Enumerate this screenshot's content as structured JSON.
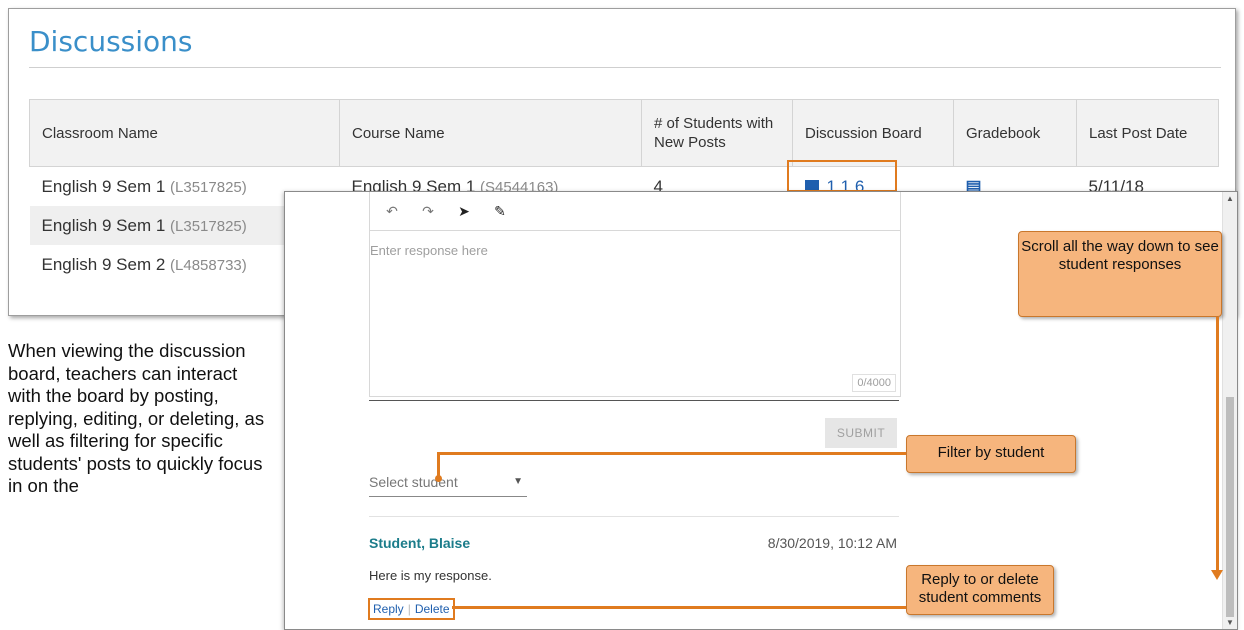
{
  "discussions": {
    "title": "Discussions",
    "columns": [
      "Classroom Name",
      "Course Name",
      "# of Students with New Posts",
      "Discussion Board",
      "Gradebook",
      "Last Post Date"
    ],
    "rows": [
      {
        "classroom": "English 9 Sem 1",
        "code": "(L3517825)",
        "course": "English 9 Sem 1",
        "course_code": "(S4544163)",
        "students": "4",
        "board": "1.1.6",
        "last_post": "5/11/18"
      },
      {
        "classroom": "English 9 Sem 1",
        "code": "(L3517825)"
      },
      {
        "classroom": "English 9 Sem 2",
        "code": "(L4858733)"
      }
    ]
  },
  "narrative": "When viewing the discussion board, teachers can interact with the board by posting, replying, editing, or deleting, as well as filtering for specific students' posts to quickly focus in on the",
  "editor": {
    "toolbar": [
      "undo-icon",
      "redo-icon",
      "pointer-icon",
      "eraser-icon"
    ],
    "placeholder": "Enter response here",
    "counter": "0/4000",
    "submit_label": "SUBMIT"
  },
  "filter": {
    "select_placeholder": "Select student"
  },
  "post": {
    "author": "Student, Blaise",
    "date": "8/30/2019, 10:12 AM",
    "body": "Here is my response.",
    "reply_label": "Reply",
    "delete_label": "Delete"
  },
  "callouts": {
    "scroll": "Scroll all the way down to see student responses",
    "filter": "Filter by student",
    "reply": "Reply to or delete student comments"
  },
  "colors": {
    "accent_orange": "#e07b1f",
    "callout_fill": "#f6b57d",
    "title_blue": "#3a8fc9",
    "author_teal": "#1b7c8a",
    "link_blue": "#1f5fae"
  }
}
